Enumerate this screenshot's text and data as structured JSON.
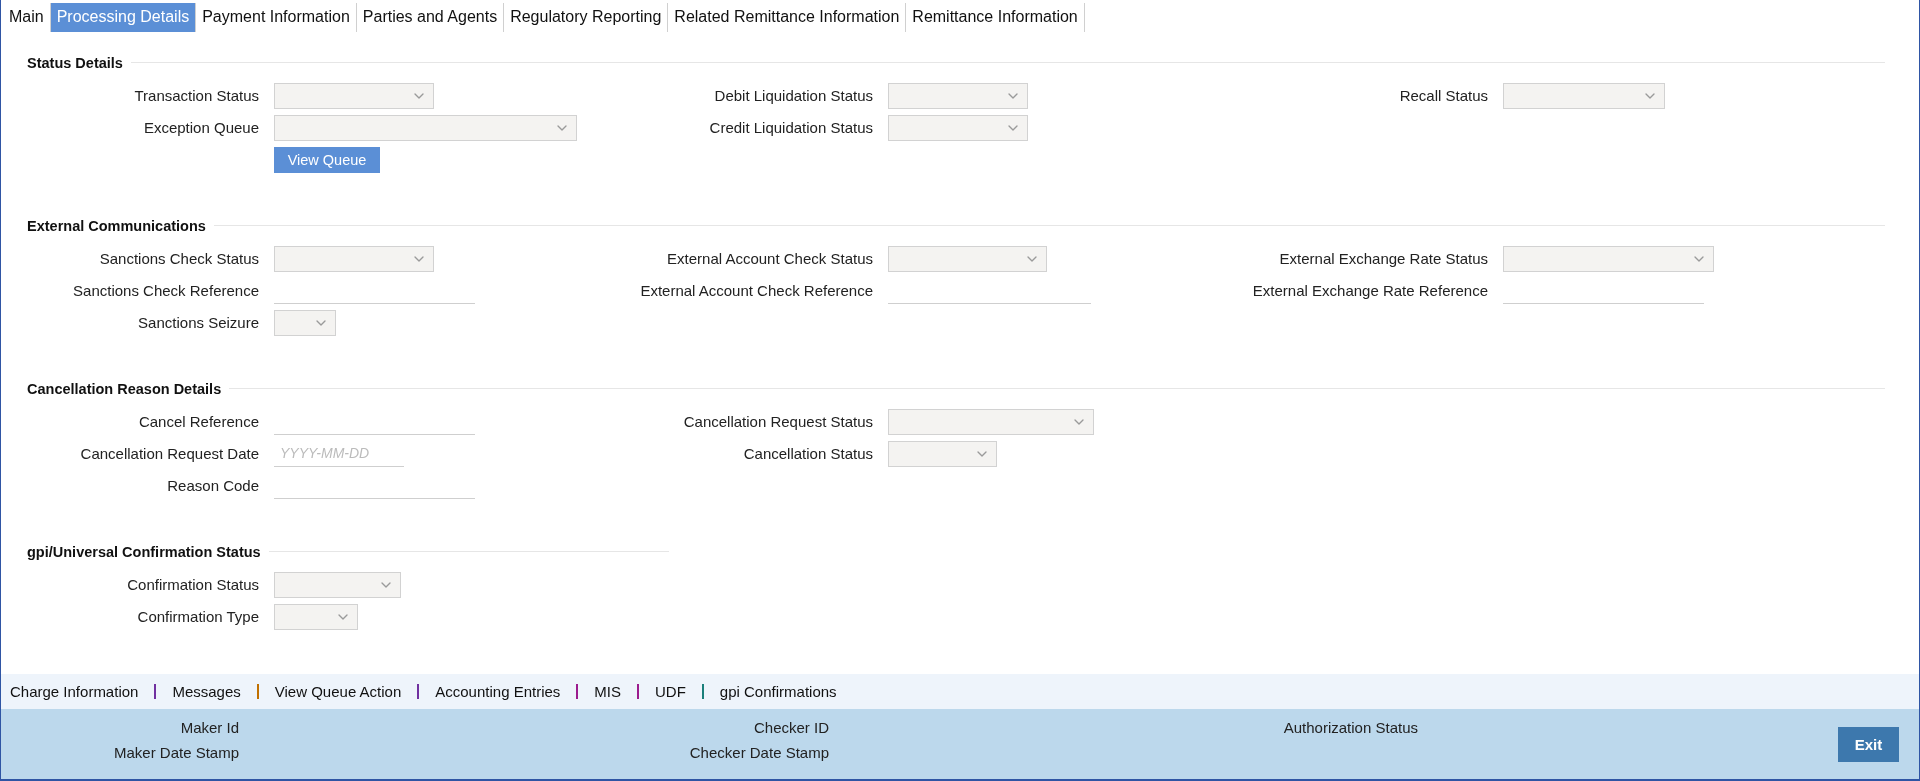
{
  "tabs": [
    {
      "label": "Main",
      "selected": false
    },
    {
      "label": "Processing Details",
      "selected": true
    },
    {
      "label": "Payment Information",
      "selected": false
    },
    {
      "label": "Parties and Agents",
      "selected": false
    },
    {
      "label": "Regulatory Reporting",
      "selected": false
    },
    {
      "label": "Related Remittance Information",
      "selected": false
    },
    {
      "label": "Remittance Information",
      "selected": false
    }
  ],
  "sections": [
    {
      "title": "Status Details",
      "rule_full_width": true,
      "columns": [
        [
          {
            "kind": "select",
            "label": "Transaction Status"
          },
          {
            "kind": "select",
            "label": "Exception Queue"
          },
          {
            "kind": "button",
            "label": "View Queue"
          }
        ],
        [
          {
            "kind": "select",
            "label": "Debit Liquidation Status"
          },
          {
            "kind": "select",
            "label": "Credit Liquidation Status"
          }
        ],
        [
          {
            "kind": "select",
            "label": "Recall Status"
          }
        ]
      ]
    },
    {
      "title": "External Communications",
      "rule_full_width": true,
      "columns": [
        [
          {
            "kind": "select",
            "label": "Sanctions Check Status"
          },
          {
            "kind": "text",
            "label": "Sanctions Check Reference"
          },
          {
            "kind": "select",
            "label": "Sanctions Seizure"
          }
        ],
        [
          {
            "kind": "select",
            "label": "External Account Check Status"
          },
          {
            "kind": "text",
            "label": "External Account Check Reference"
          }
        ],
        [
          {
            "kind": "select",
            "label": "External Exchange Rate Status"
          },
          {
            "kind": "text",
            "label": "External Exchange Rate Reference"
          }
        ]
      ]
    },
    {
      "title": "Cancellation Reason Details",
      "rule_full_width": true,
      "columns": [
        [
          {
            "kind": "text",
            "label": "Cancel Reference"
          },
          {
            "kind": "text",
            "label": "Cancellation Request Date",
            "placeholder": "YYYY-MM-DD"
          },
          {
            "kind": "text",
            "label": "Reason Code"
          }
        ],
        [
          {
            "kind": "select",
            "label": "Cancellation Request Status"
          },
          {
            "kind": "select",
            "label": "Cancellation Status"
          }
        ]
      ]
    },
    {
      "title": "gpi/Universal Confirmation Status",
      "rule_full_width": false,
      "columns": [
        [
          {
            "kind": "select",
            "label": "Confirmation Status"
          },
          {
            "kind": "select",
            "label": "Confirmation Type"
          }
        ]
      ]
    }
  ],
  "links": [
    {
      "label": "Charge Information",
      "color": "#7030a0"
    },
    {
      "label": "Messages",
      "color": "#c07000"
    },
    {
      "label": "View Queue Action",
      "color": "#7030a0"
    },
    {
      "label": "Accounting Entries",
      "color": "#9b1b8e"
    },
    {
      "label": "MIS",
      "color": "#9b1b8e"
    },
    {
      "label": "UDF",
      "color": "#1a7f7a"
    },
    {
      "label": "gpi Confirmations"
    }
  ],
  "audit": [
    [
      "Maker Id",
      "Maker Date Stamp"
    ],
    [
      "Checker ID",
      "Checker Date Stamp"
    ],
    [
      "Authorization Status"
    ]
  ],
  "exit_button": "Exit"
}
